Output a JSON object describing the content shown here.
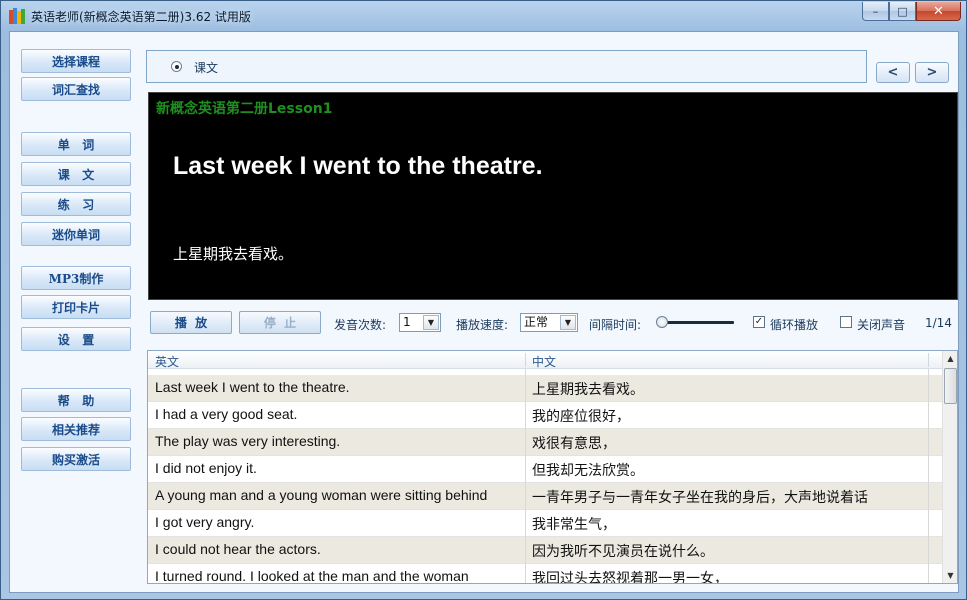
{
  "window": {
    "title": "英语老师(新概念英语第二册)3.62 试用版",
    "controls": {
      "minimize": "–",
      "maximize": "□",
      "close": "✕"
    }
  },
  "sidebar": {
    "items": [
      {
        "label": "选择课程"
      },
      {
        "label": "词汇查找"
      },
      {
        "label": "单   词"
      },
      {
        "label": "课   文"
      },
      {
        "label": "练   习"
      },
      {
        "label": "迷你单词"
      },
      {
        "label": "MP3制作"
      },
      {
        "label": "打印卡片"
      },
      {
        "label": "设   置"
      },
      {
        "label": "帮   助"
      },
      {
        "label": "相关推荐"
      },
      {
        "label": "购买激活"
      }
    ]
  },
  "mode": {
    "label": "课文",
    "selected": true
  },
  "nav": {
    "prev": "<",
    "next": ">"
  },
  "display": {
    "lesson_title": "新概念英语第二册Lesson1",
    "english": "Last week I went to the theatre.",
    "chinese": "上星期我去看戏。"
  },
  "controls": {
    "play_label": "播  放",
    "stop_label": "停  止",
    "repeat_label": "发音次数:",
    "repeat_value": "1",
    "speed_label": "播放速度:",
    "speed_value": "正常",
    "interval_label": "间隔时间:",
    "loop_label": "循环播放",
    "loop_checked": true,
    "mute_label": "关闭声音",
    "mute_checked": false,
    "counter": "1/14"
  },
  "table": {
    "columns": [
      "英文",
      "中文"
    ],
    "rows": [
      {
        "en": "Last week I went to the theatre.",
        "cn": "上星期我去看戏。"
      },
      {
        "en": "I had a very good seat.",
        "cn": "我的座位很好，"
      },
      {
        "en": "The play was very interesting.",
        "cn": "戏很有意思，"
      },
      {
        "en": "I did not enjoy it.",
        "cn": "但我却无法欣赏。"
      },
      {
        "en": "A young man and a young woman were sitting behind",
        "cn": "一青年男子与一青年女子坐在我的身后，大声地说着话"
      },
      {
        "en": "I got very angry.",
        "cn": "我非常生气，"
      },
      {
        "en": "I could not hear the actors.",
        "cn": "因为我听不见演员在说什么。"
      },
      {
        "en": "I turned round. I looked at the man and the woman",
        "cn": "我回过头去怒视着那一男一女，"
      }
    ]
  },
  "colors": {
    "lesson_title": "#1f8f1f",
    "display_bg": "#000000",
    "sidebar_text": "#1a4b8a",
    "alt_row": "#ece9e1"
  }
}
